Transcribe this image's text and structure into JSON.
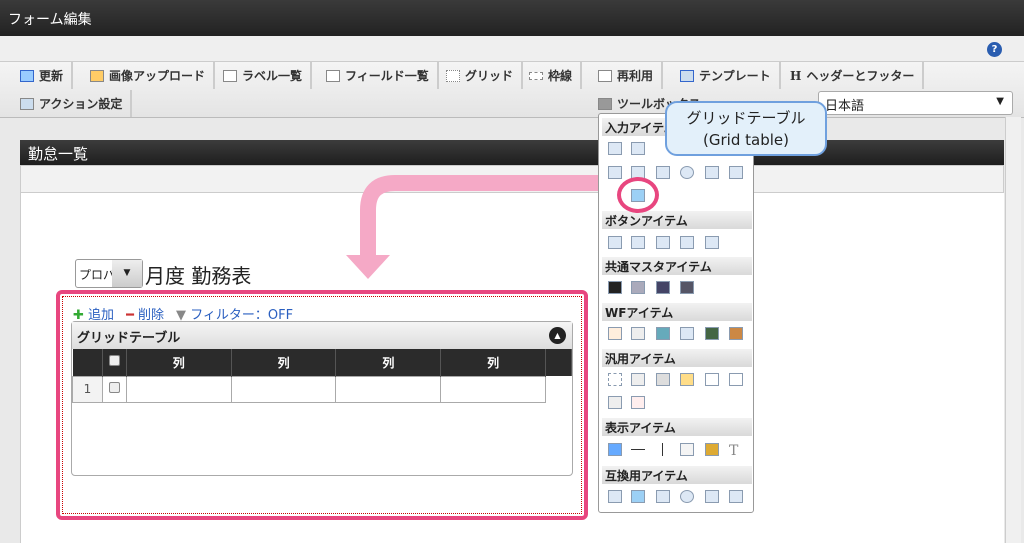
{
  "window": {
    "title": "フォーム編集",
    "help": "?"
  },
  "toolbar": {
    "tabs": [
      "更新",
      "画像アップロード",
      "ラベル一覧",
      "フィールド一覧",
      "グリッド",
      "枠線",
      "再利用",
      "テンプレート",
      "ヘッダーとフッター"
    ],
    "row2": [
      "アクション設定",
      "ツールボックス"
    ],
    "language": "日本語"
  },
  "panel": {
    "title": "勤怠一覧"
  },
  "form": {
    "select_value": "プロパ",
    "title": "月度 勤務表"
  },
  "grid": {
    "add": "追加",
    "delete": "削除",
    "filter": "フィルター：OFF",
    "caption": "グリッドテーブル",
    "columns": [
      "列",
      "列",
      "列",
      "列"
    ],
    "rows": [
      {
        "no": "1"
      }
    ]
  },
  "palette": {
    "sections": [
      "入力アイテム",
      "ボタンアイテム",
      "共通マスタアイテム",
      "WFアイテム",
      "汎用アイテム",
      "表示アイテム",
      "互換用アイテム"
    ]
  },
  "callout": {
    "line1": "グリッドテーブル",
    "line2": "(Grid table)"
  },
  "colors": {
    "highlight": "#e8467f",
    "callout_border": "#6fa0de"
  }
}
